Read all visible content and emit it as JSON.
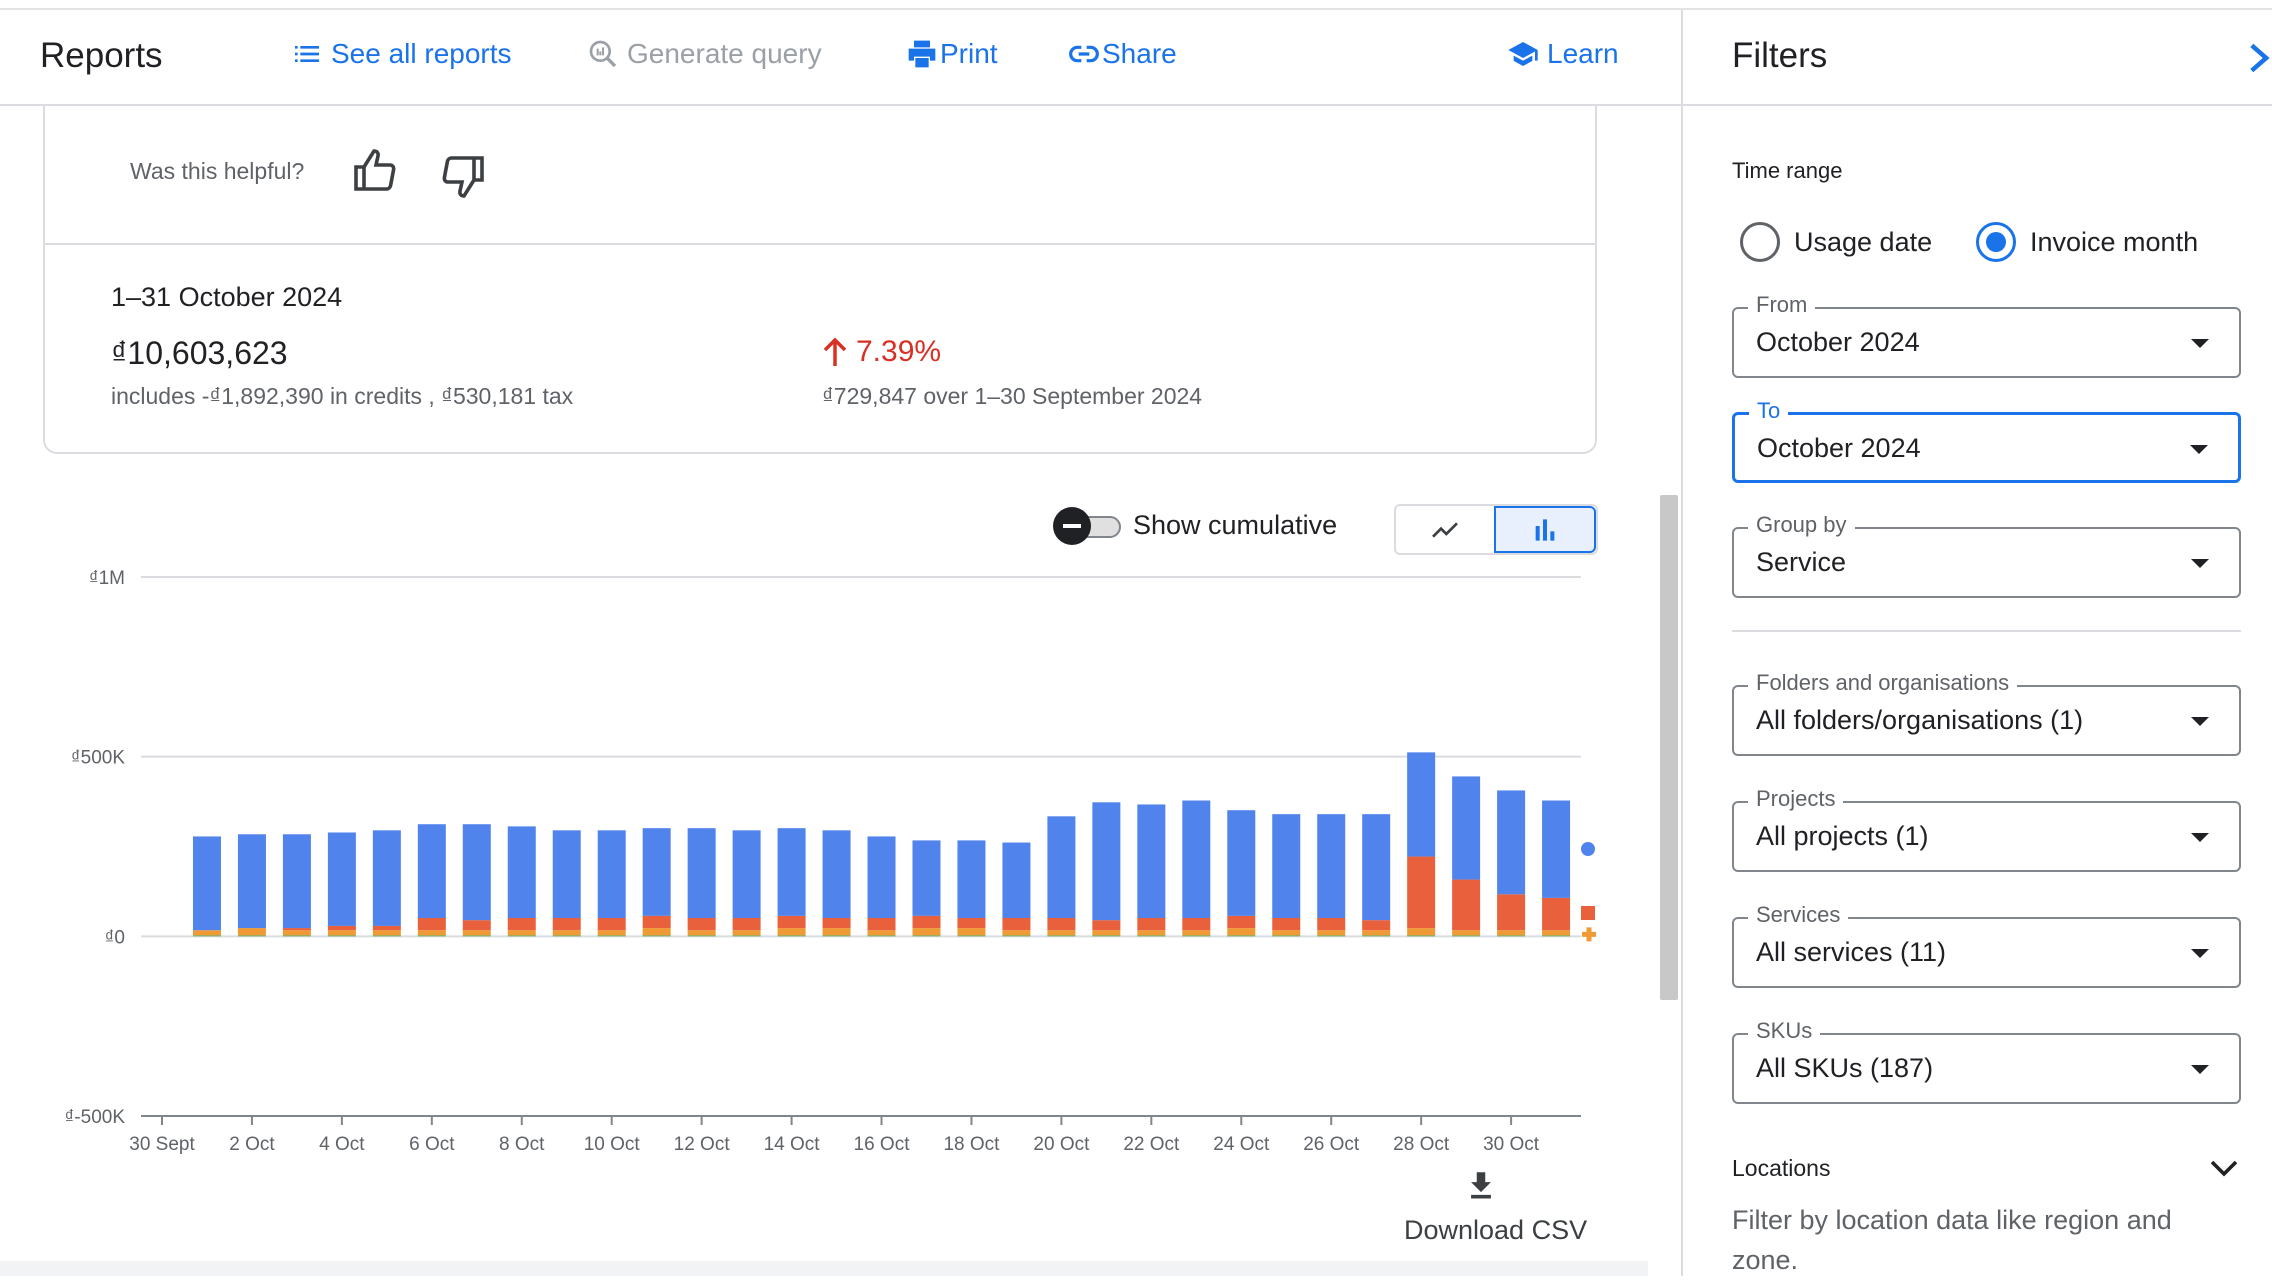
{
  "header": {
    "title": "Reports",
    "nav": [
      {
        "label": "See all reports",
        "icon": "list-icon",
        "enabled": true
      },
      {
        "label": "Generate query",
        "icon": "query-search-icon",
        "enabled": false
      },
      {
        "label": "Print",
        "icon": "print-icon",
        "enabled": true
      },
      {
        "label": "Share",
        "icon": "link-icon",
        "enabled": true
      },
      {
        "label": "Learn",
        "icon": "school-icon",
        "enabled": true
      }
    ]
  },
  "feedback": {
    "question": "Was this helpful?"
  },
  "summary": {
    "period": "1–31 October 2024",
    "amount": "₫10,603,623",
    "breakdown": "includes -₫1,892,390 in credits , ₫530,181 tax",
    "change_percent": "7.39%",
    "change_direction": "up",
    "change_detail": "₫729,847 over 1–30 September 2024"
  },
  "chart_controls": {
    "cumulative_label": "Show cumulative",
    "cumulative_on": false,
    "view": "bar",
    "download_label": "Download CSV"
  },
  "colors": {
    "accent": "#1a73e8",
    "negative_change": "#d93025"
  },
  "chart_data": {
    "type": "bar",
    "stacked": true,
    "categories": [
      "1 Oct",
      "2 Oct",
      "3 Oct",
      "4 Oct",
      "5 Oct",
      "6 Oct",
      "7 Oct",
      "8 Oct",
      "9 Oct",
      "10 Oct",
      "11 Oct",
      "12 Oct",
      "13 Oct",
      "14 Oct",
      "15 Oct",
      "16 Oct",
      "17 Oct",
      "18 Oct",
      "19 Oct",
      "20 Oct",
      "21 Oct",
      "22 Oct",
      "23 Oct",
      "24 Oct",
      "25 Oct",
      "26 Oct",
      "27 Oct",
      "28 Oct",
      "29 Oct",
      "30 Oct",
      "31 Oct"
    ],
    "x_tick_labels": [
      "30 Sept",
      "2 Oct",
      "4 Oct",
      "6 Oct",
      "8 Oct",
      "10 Oct",
      "12 Oct",
      "14 Oct",
      "16 Oct",
      "18 Oct",
      "20 Oct",
      "22 Oct",
      "24 Oct",
      "26 Oct",
      "28 Oct",
      "30 Oct"
    ],
    "y_tick_labels": [
      "₫1M",
      "₫500K",
      "₫0",
      "₫-500K"
    ],
    "y_ticks": [
      1000000,
      500000,
      0,
      -500000
    ],
    "ylim": [
      -500000,
      1000000
    ],
    "grid": true,
    "series": [
      {
        "color": "#6aa84f",
        "values": [
          3000,
          3000,
          3000,
          3000,
          3000,
          3000,
          3000,
          3000,
          3000,
          3000,
          3000,
          3000,
          3000,
          3000,
          3000,
          3000,
          3000,
          3000,
          3000,
          3000,
          3000,
          3000,
          3000,
          3000,
          3000,
          3000,
          3000,
          3000,
          3000,
          3000,
          3000
        ]
      },
      {
        "color": "#f09a36",
        "values": [
          14000,
          20000,
          14000,
          14000,
          14000,
          14000,
          14000,
          14000,
          14000,
          14000,
          20000,
          14000,
          14000,
          20000,
          20000,
          14000,
          20000,
          20000,
          14000,
          14000,
          14000,
          14000,
          14000,
          20000,
          14000,
          14000,
          14000,
          20000,
          14000,
          14000,
          14000
        ]
      },
      {
        "color": "#e8603c",
        "values": [
          0,
          0,
          6000,
          12000,
          12000,
          34000,
          28000,
          34000,
          34000,
          34000,
          34000,
          34000,
          34000,
          34000,
          28000,
          34000,
          34000,
          28000,
          34000,
          34000,
          28000,
          34000,
          34000,
          34000,
          34000,
          34000,
          28000,
          199000,
          141000,
          100000,
          90000
        ]
      },
      {
        "color": "#5083ec",
        "values": [
          261000,
          261000,
          261000,
          260000,
          266000,
          261000,
          267000,
          255000,
          244000,
          244000,
          244000,
          250000,
          244000,
          244000,
          244000,
          227000,
          210000,
          216000,
          210000,
          283000,
          328000,
          316000,
          327000,
          294000,
          289000,
          289000,
          295000,
          290000,
          287000,
          289000,
          271000
        ]
      }
    ]
  },
  "filters": {
    "title": "Filters",
    "time_range": {
      "label": "Time range",
      "options": [
        {
          "label": "Usage date",
          "selected": false
        },
        {
          "label": "Invoice month",
          "selected": true
        }
      ]
    },
    "from": {
      "label": "From",
      "value": "October 2024"
    },
    "to": {
      "label": "To",
      "value": "October 2024"
    },
    "group_by": {
      "label": "Group by",
      "value": "Service"
    },
    "folders": {
      "label": "Folders and organisations",
      "value": "All folders/organisations (1)"
    },
    "projects": {
      "label": "Projects",
      "value": "All projects (1)"
    },
    "services": {
      "label": "Services",
      "value": "All services (11)"
    },
    "skus": {
      "label": "SKUs",
      "value": "All SKUs (187)"
    },
    "locations": {
      "label": "Locations",
      "description": "Filter by location data like region and zone."
    }
  }
}
